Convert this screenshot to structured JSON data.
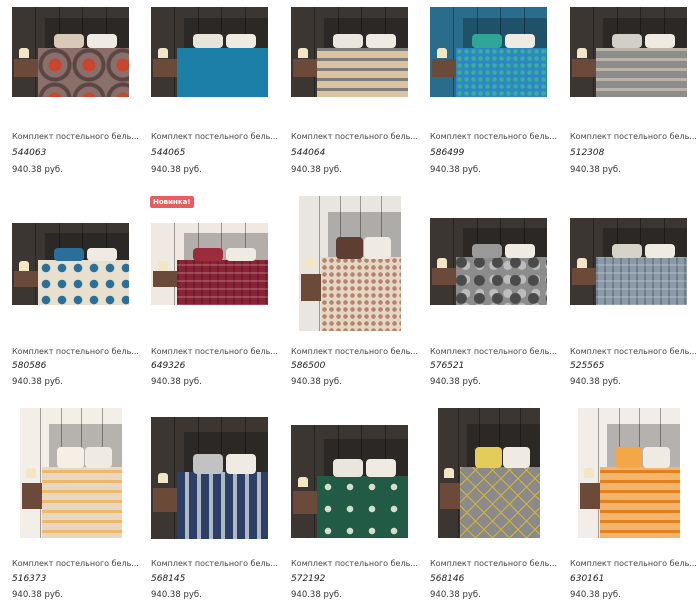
{
  "products": [
    {
      "title": "Комплект постельного бель...",
      "sku": "544063",
      "price": "940.38 руб.",
      "badge": ""
    },
    {
      "title": "Комплект постельного бель...",
      "sku": "544065",
      "price": "940.38 руб.",
      "badge": ""
    },
    {
      "title": "Комплект постельного бель...",
      "sku": "544064",
      "price": "940.38 руб.",
      "badge": ""
    },
    {
      "title": "Комплект постельного бель...",
      "sku": "586499",
      "price": "940.38 руб.",
      "badge": ""
    },
    {
      "title": "Комплект постельного бель...",
      "sku": "512308",
      "price": "940.38 руб.",
      "badge": ""
    },
    {
      "title": "Комплект постельного бель...",
      "sku": "580586",
      "price": "940.38 руб.",
      "badge": ""
    },
    {
      "title": "Комплект постельного бель...",
      "sku": "649326",
      "price": "940.38 руб.",
      "badge": "Новинка!"
    },
    {
      "title": "Комплект постельного бель...",
      "sku": "586500",
      "price": "940.38 руб.",
      "badge": ""
    },
    {
      "title": "Комплект постельного бель...",
      "sku": "576521",
      "price": "940.38 руб.",
      "badge": ""
    },
    {
      "title": "Комплект постельного бель...",
      "sku": "525565",
      "price": "940.38 руб.",
      "badge": ""
    },
    {
      "title": "Комплект постельного бель...",
      "sku": "516373",
      "price": "940.38 руб.",
      "badge": ""
    },
    {
      "title": "Комплект постельного бель...",
      "sku": "568145",
      "price": "940.38 руб.",
      "badge": ""
    },
    {
      "title": "Комплект постельного бель...",
      "sku": "572192",
      "price": "940.38 руб.",
      "badge": ""
    },
    {
      "title": "Комплект постельного бель...",
      "sku": "568146",
      "price": "940.38 руб.",
      "badge": ""
    },
    {
      "title": "Комплект постельного бель...",
      "sku": "630161",
      "price": "940.38 руб.",
      "badge": ""
    }
  ],
  "images": [
    {
      "wall": "#3b3632",
      "bed": "#8a6f6a",
      "accent": "#c9462e",
      "pattern": "damask",
      "pillow": "#d9c9b8"
    },
    {
      "wall": "#3b3632",
      "bed": "#1c7fa8",
      "accent": "#0e5f84",
      "pattern": "plain",
      "pillow": "#e8e4dc"
    },
    {
      "wall": "#3b3632",
      "bed": "#dcc3a0",
      "accent": "#7d7d7d",
      "pattern": "stripe",
      "pillow": "#ece7de"
    },
    {
      "wall": "#2a6c8c",
      "bed": "#2e86c8",
      "accent": "#39b08f",
      "pattern": "dots",
      "pillow": "#2fa796"
    },
    {
      "wall": "#3b3632",
      "bed": "#8c8c8c",
      "accent": "#b9b3a8",
      "pattern": "stripe",
      "pillow": "#d2cfc8"
    },
    {
      "wall": "#3b3632",
      "bed": "#e7e0cf",
      "accent": "#2a6f9a",
      "pattern": "cross",
      "pillow": "#2a6f9a"
    },
    {
      "wall": "#efe9e2",
      "bed": "#8a2335",
      "accent": "#f2e6d6",
      "pattern": "plaid",
      "pillow": "#9c2b3c"
    },
    {
      "wall": "#e9e6e1",
      "bed": "#e7d6c4",
      "accent": "#b0856d",
      "pattern": "dots",
      "pillow": "#5e3d33"
    },
    {
      "wall": "#3b3632",
      "bed": "#8c8c8c",
      "accent": "#4a4a4a",
      "pattern": "camo",
      "pillow": "#9a9a9a"
    },
    {
      "wall": "#3b3632",
      "bed": "#8a9aa8",
      "accent": "#6b7a88",
      "pattern": "plaid",
      "pillow": "#d8d3c8"
    },
    {
      "wall": "#f3eee8",
      "bed": "#e8d8c2",
      "accent": "#f0b86d",
      "pattern": "stripe",
      "pillow": "#f6efe6"
    },
    {
      "wall": "#3b3632",
      "bed": "#2c3f66",
      "accent": "#b0b8c4",
      "pattern": "vstripe",
      "pillow": "#c2c2c2"
    },
    {
      "wall": "#3b3632",
      "bed": "#215a45",
      "accent": "#d7ddd0",
      "pattern": "ornament",
      "pillow": "#e9e6de"
    },
    {
      "wall": "#3b3632",
      "bed": "#8a8a8a",
      "accent": "#d4b338",
      "pattern": "diamond",
      "pillow": "#e3cc5a"
    },
    {
      "wall": "#f2ede8",
      "bed": "#f2b56b",
      "accent": "#e37f1f",
      "pattern": "stripe",
      "pillow": "#f4a746"
    }
  ]
}
